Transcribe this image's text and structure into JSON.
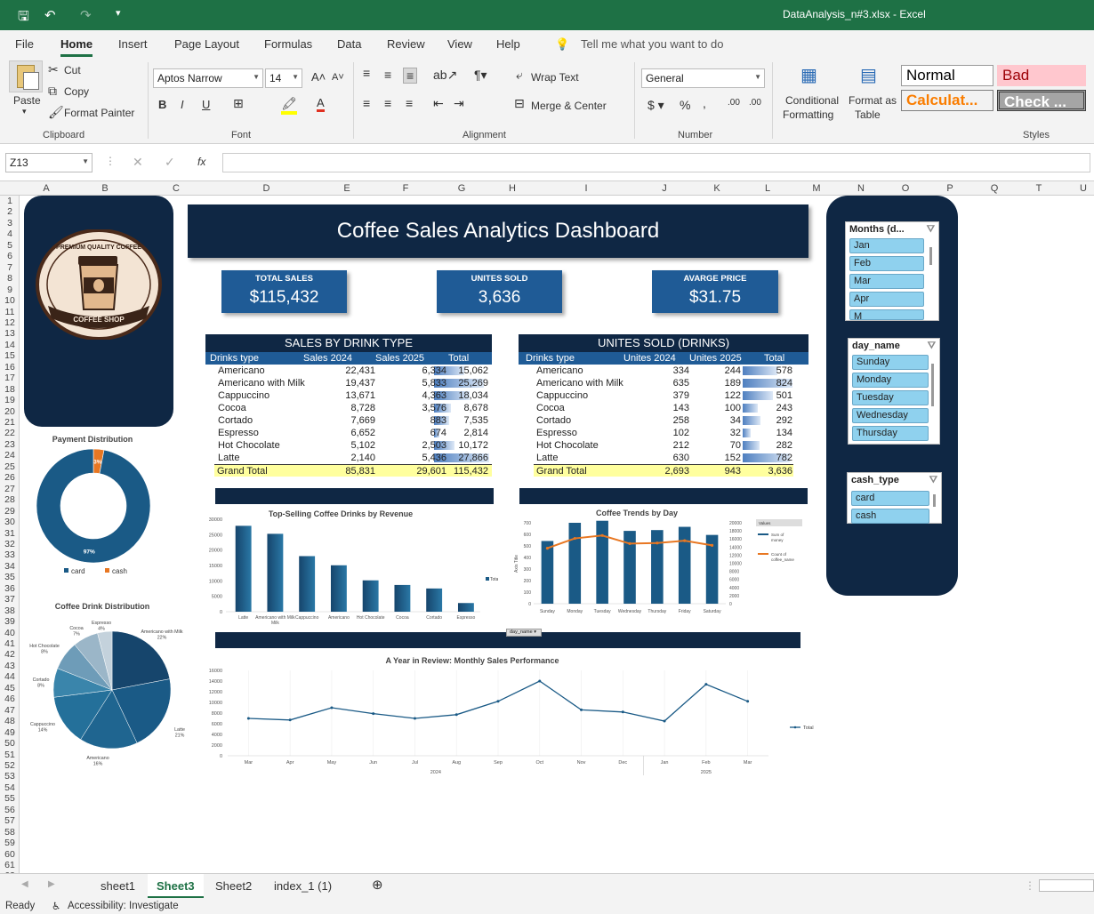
{
  "window": {
    "title": "DataAnalysis_n#3.xlsx  -  Excel"
  },
  "menu": [
    "File",
    "Home",
    "Insert",
    "Page Layout",
    "Formulas",
    "Data",
    "Review",
    "View",
    "Help"
  ],
  "tell_me": "Tell me what you want to do",
  "ribbon": {
    "paste": "Paste",
    "cut": "Cut",
    "copy": "Copy",
    "format_painter": "Format Painter",
    "clipboard": "Clipboard",
    "font_name": "Aptos Narrow",
    "font_size": "14",
    "font": "Font",
    "wrap": "Wrap Text",
    "merge": "Merge & Center",
    "alignment": "Alignment",
    "number_format": "General",
    "number": "Number",
    "cond1": "Conditional",
    "cond2": "Formatting",
    "fmt1": "Format as",
    "fmt2": "Table",
    "styles": "Styles",
    "style_normal": "Normal",
    "style_bad": "Bad",
    "style_calc": "Calculat...",
    "style_check": "Check ..."
  },
  "formula": {
    "name_box": "Z13",
    "fx": "fx",
    "value": ""
  },
  "columns": [
    "A",
    "B",
    "C",
    "D",
    "E",
    "F",
    "G",
    "H",
    "I",
    "J",
    "K",
    "L",
    "M",
    "N",
    "O",
    "P",
    "Q",
    "T",
    "U"
  ],
  "rows": [
    "1",
    "2",
    "3",
    "4",
    "5",
    "6",
    "7",
    "8",
    "9",
    "10",
    "11",
    "12",
    "13",
    "14",
    "15",
    "16",
    "17",
    "18",
    "19",
    "20",
    "21",
    "22",
    "23",
    "24",
    "25",
    "26",
    "27",
    "28",
    "29",
    "30",
    "31",
    "32",
    "33",
    "34",
    "35",
    "36",
    "37",
    "38",
    "39",
    "40",
    "41",
    "42",
    "43",
    "44",
    "45",
    "46",
    "47",
    "48",
    "49",
    "50",
    "51",
    "52",
    "53",
    "54",
    "55",
    "56",
    "57",
    "58",
    "59",
    "60",
    "61",
    "62"
  ],
  "logo": {
    "top": "PREMIUM QUALITY COFFEE",
    "bottom": "COFFEE SHOP"
  },
  "dashboard": {
    "title": "Coffee Sales Analytics Dashboard",
    "kpis": [
      {
        "label": "TOTAL SALES",
        "value": "$115,432"
      },
      {
        "label": "UNITES SOLD",
        "value": "3,636"
      },
      {
        "label": "AVARGE PRICE",
        "value": "$31.75"
      }
    ],
    "sales_table": {
      "title": "SALES BY DRINK TYPE",
      "headers": [
        "Drinks type",
        "Sales 2024",
        "Sales 2025",
        "Total"
      ],
      "rows": [
        [
          "Americano",
          "22,431",
          "6,334",
          "15,062"
        ],
        [
          "Americano with Milk",
          "19,437",
          "5,833",
          "25,269"
        ],
        [
          "Cappuccino",
          "13,671",
          "4,363",
          "18,034"
        ],
        [
          "Cocoa",
          "8,728",
          "3,576",
          "8,678"
        ],
        [
          "Cortado",
          "7,669",
          "883",
          "7,535"
        ],
        [
          "Espresso",
          "6,652",
          "674",
          "2,814"
        ],
        [
          "Hot Chocolate",
          "5,102",
          "2,503",
          "10,172"
        ],
        [
          "Latte",
          "2,140",
          "5,436",
          "27,866"
        ]
      ],
      "bar_values": [
        15062,
        25269,
        18034,
        8678,
        7535,
        2814,
        10172,
        27866
      ],
      "grand": [
        "Grand Total",
        "85,831",
        "29,601",
        "115,432"
      ]
    },
    "units_table": {
      "title": "UNITES SOLD (DRINKS)",
      "headers": [
        "Drinks type",
        "Unites 2024",
        "Unites 2025",
        "Total"
      ],
      "rows": [
        [
          "Americano",
          "334",
          "244",
          "578"
        ],
        [
          "Americano with Milk",
          "635",
          "189",
          "824"
        ],
        [
          "Cappuccino",
          "379",
          "122",
          "501"
        ],
        [
          "Cocoa",
          "143",
          "100",
          "243"
        ],
        [
          "Cortado",
          "258",
          "34",
          "292"
        ],
        [
          "Espresso",
          "102",
          "32",
          "134"
        ],
        [
          "Hot Chocolate",
          "212",
          "70",
          "282"
        ],
        [
          "Latte",
          "630",
          "152",
          "782"
        ]
      ],
      "bar_values": [
        578,
        824,
        501,
        243,
        292,
        134,
        282,
        782
      ],
      "grand": [
        "Grand Total",
        "2,693",
        "943",
        "3,636"
      ]
    },
    "slicers": {
      "months": {
        "title": "Months (d...",
        "items": [
          "Jan",
          "Feb",
          "Mar",
          "Apr",
          "M"
        ]
      },
      "day_name": {
        "title": "day_name",
        "items": [
          "Sunday",
          "Monday",
          "Tuesday",
          "Wednesday",
          "Thursday"
        ]
      },
      "cash_type": {
        "title": "cash_type",
        "items": [
          "card",
          "cash"
        ]
      }
    },
    "filter_button": "day_name"
  },
  "chart_data": [
    {
      "type": "pie",
      "title": "Payment Distribution",
      "categories": [
        "card",
        "cash"
      ],
      "values": [
        97,
        3
      ],
      "labels": [
        "97%",
        "3%"
      ],
      "colors": [
        "#1a5a86",
        "#e87722"
      ],
      "legend": "bottom",
      "donut": true
    },
    {
      "type": "bar",
      "title": "Top-Selling Coffee Drinks by Revenue",
      "categories": [
        "Latte",
        "Americano with Milk",
        "Cappuccino",
        "Americano",
        "Hot Chocolate",
        "Cocoa",
        "Cortado",
        "Espresso"
      ],
      "values": [
        27866,
        25269,
        18034,
        15062,
        10172,
        8678,
        7535,
        2814
      ],
      "series": [
        {
          "name": "Total",
          "values": [
            27866,
            25269,
            18034,
            15062,
            10172,
            8678,
            7535,
            2814
          ]
        }
      ],
      "ylim": [
        0,
        30000
      ],
      "yticks": [
        "0",
        "5000",
        "10000",
        "15000",
        "20000",
        "25000",
        "30000"
      ],
      "legend": "right"
    },
    {
      "type": "bar",
      "title": "Coffee Trends by Day",
      "categories": [
        "Sunday",
        "Monday",
        "Tuesday",
        "Wednesday",
        "Thursday",
        "Friday",
        "Saturday"
      ],
      "series": [
        {
          "name": "Sum of money",
          "values": [
            15500,
            20000,
            20500,
            18000,
            18200,
            19000,
            17000
          ]
        },
        {
          "name": "Count of coffee_name",
          "values": [
            480,
            565,
            590,
            520,
            525,
            545,
            505
          ]
        }
      ],
      "ylim": [
        0,
        700
      ],
      "y2lim": [
        0,
        20000
      ],
      "yticks": [
        "0",
        "100",
        "200",
        "300",
        "400",
        "500",
        "600",
        "700"
      ],
      "y2ticks": [
        "0",
        "2000",
        "4000",
        "6000",
        "8000",
        "10000",
        "12000",
        "14000",
        "16000",
        "18000",
        "20000"
      ],
      "ylabel": "Axis Title",
      "legend_title": "Values",
      "legend": "right"
    },
    {
      "type": "pie",
      "title": "Coffee Drink Distribution",
      "categories": [
        "Americano with Milk",
        "Latte",
        "Americano",
        "Cappuccino",
        "Cortado",
        "Hot Chocolate",
        "Cocoa",
        "Espresso"
      ],
      "values": [
        22,
        21,
        16,
        14,
        8,
        8,
        7,
        4
      ],
      "labels": [
        "Americano with Milk\n22%",
        "Latte\n21%",
        "Americano\n16%",
        "Cappuccino\n14%",
        "Cortado\n8%",
        "Hot Chocolate\n8%",
        "Cocoa\n7%",
        "Espresso\n4%"
      ]
    },
    {
      "type": "line",
      "title": "A Year in Review: Monthly Sales Performance",
      "categories": [
        "Mar",
        "Apr",
        "May",
        "Jun",
        "Jul",
        "Aug",
        "Sep",
        "Oct",
        "Nov",
        "Dec",
        "Jan",
        "Feb",
        "Mar"
      ],
      "groups": [
        "2024",
        "2025"
      ],
      "series": [
        {
          "name": "Total",
          "values": [
            7000,
            6700,
            9000,
            7900,
            7000,
            7700,
            10200,
            14000,
            8600,
            8200,
            6500,
            13400,
            10200
          ]
        }
      ],
      "ylim": [
        0,
        16000
      ],
      "yticks": [
        "0",
        "2000",
        "4000",
        "6000",
        "8000",
        "10000",
        "12000",
        "14000",
        "16000"
      ],
      "legend": "right"
    }
  ],
  "sheets": [
    "sheet1",
    "Sheet3",
    "Sheet2",
    "index_1 (1)"
  ],
  "status": {
    "ready": "Ready",
    "accessibility": "Accessibility: Investigate"
  }
}
